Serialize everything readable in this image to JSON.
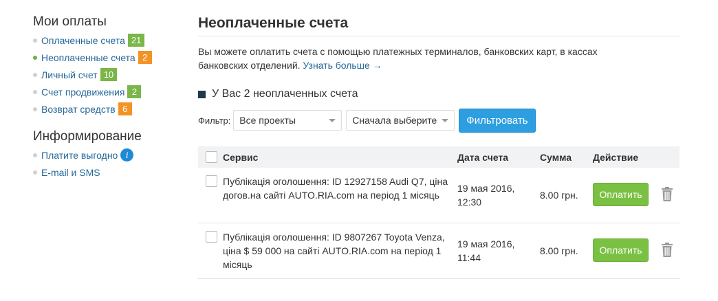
{
  "sidebar": {
    "payments_title": "Мои оплаты",
    "payments": [
      {
        "label": "Оплаченные счета",
        "badge": "21",
        "badge_color": "#7ab648",
        "active": false
      },
      {
        "label": "Неоплаченные счета",
        "badge": "2",
        "badge_color": "#f39325",
        "active": true
      },
      {
        "label": "Личный счет",
        "badge": "10",
        "badge_color": "#7ab648",
        "active": false
      },
      {
        "label": "Счет продвижения",
        "badge": "2",
        "badge_color": "#7ab648",
        "active": false
      },
      {
        "label": "Возврат средств",
        "badge": "6",
        "badge_color": "#f39325",
        "active": false
      }
    ],
    "info_title": "Информирование",
    "info": [
      {
        "label": "Платите выгодно",
        "icon": "info-icon"
      },
      {
        "label": "E-mail и SMS"
      }
    ]
  },
  "main": {
    "title": "Неоплаченные счета",
    "description": "Вы можете оплатить счета с помощью платежных терминалов, банковских карт, в кассах банковских отделений.",
    "learn_more": "Узнать больше →",
    "section_title": "У Вас 2 неоплаченных счета",
    "filter": {
      "label": "Фильтр:",
      "projects_value": "Все проекты",
      "choose_value": "Сначала выберите",
      "button": "Фильтровать"
    },
    "table": {
      "headers": {
        "service": "Сервис",
        "date": "Дата счета",
        "sum": "Сумма",
        "action": "Действие"
      },
      "rows": [
        {
          "service": "Публікація оголошення: ID 12927158 Audi Q7, ціна догов.на сайті AUTO.RIA.com на період 1 місяць",
          "date_line1": "19 мая 2016,",
          "date_line2": "12:30",
          "sum": "8.00 грн.",
          "pay": "Оплатить"
        },
        {
          "service": "Публікація оголошення: ID 9807267 Toyota Venza, ціна $ 59 000 на сайті AUTO.RIA.com на період 1 місяць",
          "date_line1": "19 мая 2016,",
          "date_line2": "11:44",
          "sum": "8.00 грн.",
          "pay": "Оплатить"
        }
      ]
    }
  },
  "colors": {
    "link": "#256799",
    "pay_button": "#7ac143",
    "filter_button": "#2d9fe0",
    "badge_green": "#7ab648",
    "badge_orange": "#f39325"
  }
}
